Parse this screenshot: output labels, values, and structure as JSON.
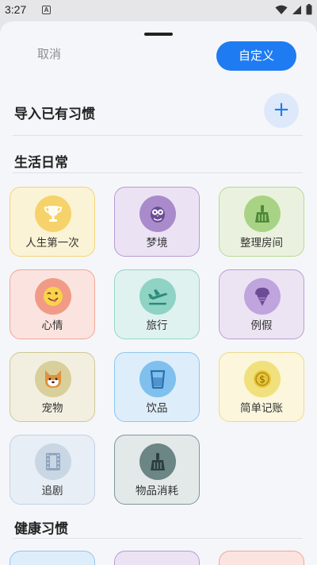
{
  "status_bar": {
    "time": "3:27",
    "notif_glyph": "A"
  },
  "header": {
    "cancel_label": "取消",
    "custom_label": "自定义"
  },
  "import": {
    "title": "导入已有习惯",
    "plus": "+"
  },
  "sections": {
    "daily": {
      "title": "生活日常"
    },
    "health": {
      "title": "健康习惯"
    }
  },
  "habits": [
    {
      "label": "人生第一次",
      "icon": "trophy-icon",
      "bg": "#fbf3d6",
      "border": "#f1d57a",
      "circle": "#f6d26a"
    },
    {
      "label": "梦境",
      "icon": "owl-icon",
      "bg": "#ebe3f3",
      "border": "#b79ad6",
      "circle": "#a98bcb"
    },
    {
      "label": "整理房间",
      "icon": "broom-icon",
      "bg": "#eaf2df",
      "border": "#b9d98e",
      "circle": "#a9d384"
    },
    {
      "label": "心情",
      "icon": "emoji-icon",
      "bg": "#fbe4df",
      "border": "#f1a794",
      "circle": "#f19b86"
    },
    {
      "label": "旅行",
      "icon": "airplane-icon",
      "bg": "#dff2ef",
      "border": "#93d6c8",
      "circle": "#8ed3c4"
    },
    {
      "label": "例假",
      "icon": "icecream-icon",
      "bg": "#ece4f3",
      "border": "#b99ed6",
      "circle": "#bfa4dd"
    },
    {
      "label": "宠物",
      "icon": "shiba-icon",
      "bg": "#f2efe0",
      "border": "#cfc894",
      "circle": "#d9cf9a"
    },
    {
      "label": "饮品",
      "icon": "cup-icon",
      "bg": "#ddeefa",
      "border": "#8fc6ef",
      "circle": "#7fc0ee"
    },
    {
      "label": "简单记账",
      "icon": "coin-icon",
      "bg": "#fbf6dc",
      "border": "#ecdb8a",
      "circle": "#f1e17d"
    },
    {
      "label": "追剧",
      "icon": "film-icon",
      "bg": "#e8eef6",
      "border": "#c3d1e3",
      "circle": "#c9d6e4"
    },
    {
      "label": "物品消耗",
      "icon": "broom-dark-icon",
      "bg": "#e3e9e9",
      "border": "#7f9696",
      "circle": "#6c8585"
    }
  ],
  "health_partial": [
    {
      "bg": "#ddeefa",
      "border": "#8fc6ef"
    },
    {
      "bg": "#ebe3f3",
      "border": "#b79ad6"
    },
    {
      "bg": "#fbe4df",
      "border": "#f1a794"
    }
  ]
}
